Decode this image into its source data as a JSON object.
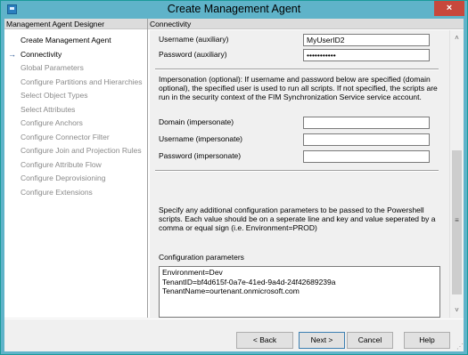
{
  "window": {
    "title": "Create Management Agent",
    "close_glyph": "×"
  },
  "left_pane": {
    "header": "Management Agent Designer",
    "items": [
      {
        "label": "Create Management Agent",
        "state": "done"
      },
      {
        "label": "Connectivity",
        "state": "current"
      },
      {
        "label": "Global Parameters",
        "state": "pending"
      },
      {
        "label": "Configure Partitions and Hierarchies",
        "state": "pending"
      },
      {
        "label": "Select Object Types",
        "state": "pending"
      },
      {
        "label": "Select Attributes",
        "state": "pending"
      },
      {
        "label": "Configure Anchors",
        "state": "pending"
      },
      {
        "label": "Configure Connector Filter",
        "state": "pending"
      },
      {
        "label": "Configure Join and Projection Rules",
        "state": "pending"
      },
      {
        "label": "Configure Attribute Flow",
        "state": "pending"
      },
      {
        "label": "Configure Deprovisioning",
        "state": "pending"
      },
      {
        "label": "Configure Extensions",
        "state": "pending"
      }
    ],
    "current_arrow": "→"
  },
  "right_pane": {
    "header": "Connectivity",
    "username_aux_label": "Username (auxiliary)",
    "username_aux_value": "MyUserID2",
    "password_aux_label": "Password (auxiliary)",
    "password_aux_value": "•••••••••••",
    "impersonation_text": "Impersonation (optional): If username and password below are specified (domain optional), the specified user is used to run all scripts. If not specified, the scripts are run in the security context of the FIM Synchronization Service service account.",
    "domain_imp_label": "Domain (impersonate)",
    "domain_imp_value": "",
    "username_imp_label": "Username (impersonate)",
    "username_imp_value": "",
    "password_imp_label": "Password  (impersonate)",
    "password_imp_value": "",
    "config_text": "Specify any additional configuration parameters to be passed to the Powershell scripts. Each value should be on a seperate line and key and value seperated by a comma or equal sign (i.e. Environment=PROD)",
    "config_label": "Configuration parameters",
    "config_value": "Environment=Dev\nTenantID=bf4d615f-0a7e-41ed-9a4d-24f42689239a\nTenantName=ourtenant.onmicrosoft.com"
  },
  "scrollbar": {
    "up_glyph": "˄",
    "down_glyph": "˅",
    "grip_glyph": "≡"
  },
  "buttons": {
    "back": "< Back",
    "next": "Next >",
    "cancel": "Cancel",
    "help": "Help"
  },
  "resize_grip_glyph": "⋰"
}
